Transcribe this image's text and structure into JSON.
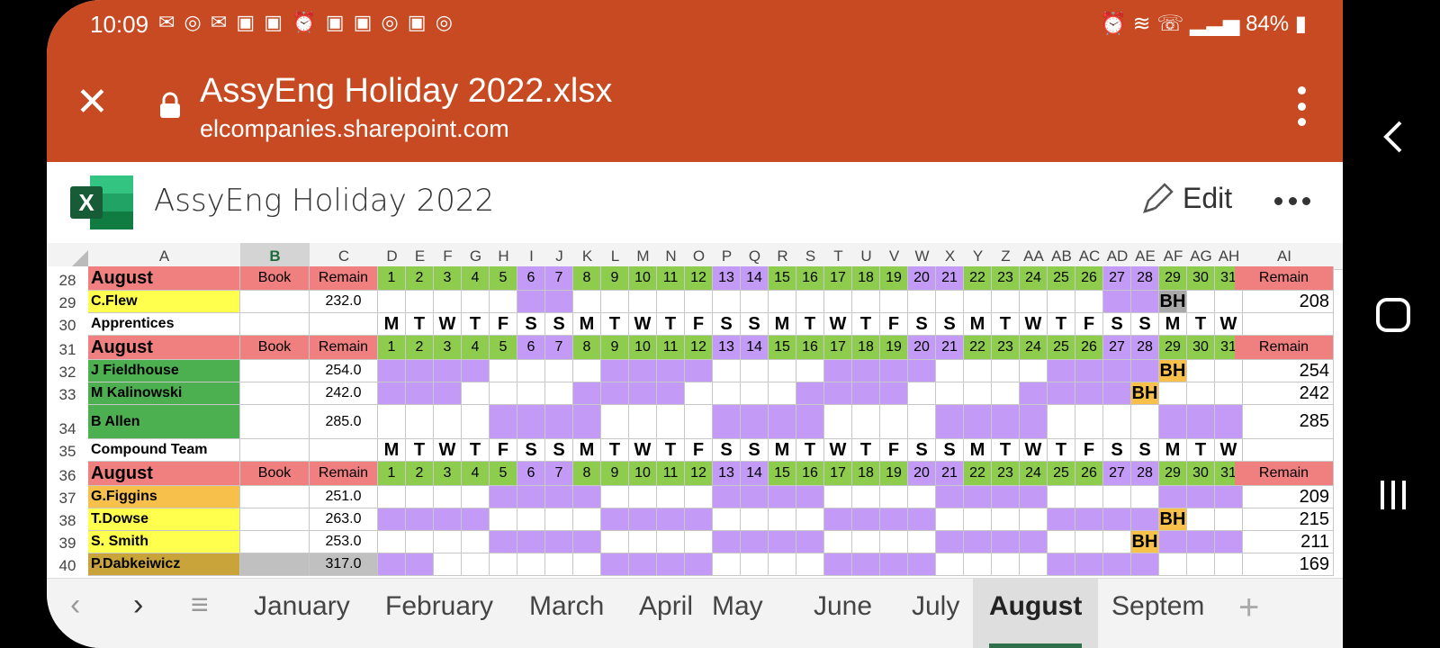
{
  "status": {
    "time": "10:09",
    "battery": "84%"
  },
  "browser": {
    "title": "AssyEng Holiday 2022.xlsx",
    "host": "elcompanies.sharepoint.com"
  },
  "excel": {
    "doc_title": "AssyEng Holiday 2022",
    "edit_label": "Edit"
  },
  "colors": {
    "brand": "#c84a22",
    "purple": "#c39bf7",
    "green_hdr": "#8dcc4d",
    "salmon": "#f08080",
    "name_green": "#4caf50",
    "name_yellow": "#ffff4d",
    "name_orange": "#f7c04a",
    "bh": "#f7c04a"
  },
  "columns": [
    "A",
    "B",
    "C",
    "D",
    "E",
    "F",
    "G",
    "H",
    "I",
    "J",
    "K",
    "L",
    "M",
    "N",
    "O",
    "P",
    "Q",
    "R",
    "S",
    "T",
    "U",
    "V",
    "W",
    "X",
    "Y",
    "Z",
    "AA",
    "AB",
    "AC",
    "AD",
    "AE",
    "AF",
    "AG",
    "AH",
    "AI"
  ],
  "weekdays": [
    "M",
    "T",
    "W",
    "T",
    "F",
    "S",
    "S",
    "M",
    "T",
    "W",
    "T",
    "F",
    "S",
    "S",
    "M",
    "T",
    "W",
    "T",
    "F",
    "S",
    "S",
    "M",
    "T",
    "W",
    "T",
    "F",
    "S",
    "S",
    "M",
    "T",
    "W"
  ],
  "days": [
    "1",
    "2",
    "3",
    "4",
    "5",
    "6",
    "7",
    "8",
    "9",
    "10",
    "11",
    "12",
    "13",
    "14",
    "15",
    "16",
    "17",
    "18",
    "19",
    "20",
    "21",
    "22",
    "23",
    "24",
    "25",
    "26",
    "27",
    "28",
    "29",
    "30",
    "31"
  ],
  "rows": [
    {
      "num": "28",
      "type": "header",
      "month": "August",
      "book": "Book",
      "remain": "Remain",
      "remain2": "Remain"
    },
    {
      "num": "29",
      "type": "person",
      "name": "C.Flew",
      "color": "yellow",
      "remain": "232.0",
      "total": "208",
      "purple": [
        6,
        7,
        27,
        28
      ],
      "bh": 29,
      "bh_grey": true
    },
    {
      "num": "30",
      "type": "weekday",
      "label": "Apprentices"
    },
    {
      "num": "31",
      "type": "header",
      "month": "August",
      "book": "Book",
      "remain": "Remain",
      "remain2": "Remain"
    },
    {
      "num": "32",
      "type": "person",
      "name": "J Fieldhouse",
      "color": "green",
      "remain": "254.0",
      "total": "254",
      "purple": [
        1,
        2,
        3,
        4,
        9,
        10,
        11,
        12,
        17,
        18,
        19,
        20,
        25,
        26,
        27,
        28
      ],
      "bh": 29
    },
    {
      "num": "33",
      "type": "person",
      "name": "M Kalinowski",
      "color": "green",
      "remain": "242.0",
      "total": "242",
      "purple": [
        1,
        2,
        3,
        8,
        9,
        10,
        11,
        16,
        17,
        18,
        19,
        24,
        25,
        26,
        27
      ],
      "bh": 28
    },
    {
      "num": "34",
      "type": "person",
      "name": "B Allen",
      "color": "green",
      "remain": "285.0",
      "total": "285",
      "purple": [
        5,
        6,
        7,
        8,
        13,
        14,
        15,
        16,
        21,
        22,
        23,
        24,
        29,
        30,
        31
      ],
      "tall": true
    },
    {
      "num": "35",
      "type": "weekday",
      "label": "Compound Team"
    },
    {
      "num": "36",
      "type": "header",
      "month": "August",
      "book": "Book",
      "remain": "Remain",
      "remain2": "Remain"
    },
    {
      "num": "37",
      "type": "person",
      "name": "G.Figgins",
      "color": "orange",
      "remain": "251.0",
      "total": "209",
      "purple": [
        5,
        6,
        7,
        8,
        13,
        14,
        15,
        16,
        21,
        22,
        23,
        24,
        29,
        30,
        31
      ]
    },
    {
      "num": "38",
      "type": "person",
      "name": "T.Dowse",
      "color": "yellow",
      "remain": "263.0",
      "total": "215",
      "purple": [
        1,
        2,
        3,
        4,
        9,
        10,
        11,
        12,
        17,
        18,
        19,
        20,
        25,
        26,
        27,
        28
      ],
      "bh": 29
    },
    {
      "num": "39",
      "type": "person",
      "name": "S. Smith",
      "color": "yellow",
      "remain": "253.0",
      "total": "211",
      "purple": [
        5,
        6,
        7,
        8,
        13,
        14,
        15,
        16,
        21,
        22,
        23,
        24,
        29,
        30,
        31
      ],
      "bh": 28
    },
    {
      "num": "40",
      "type": "person",
      "name": "P.Dabkeiwicz",
      "color": "olive",
      "remain": "317.0",
      "total": "169",
      "purple": [
        1,
        2,
        9,
        10,
        11,
        12,
        17,
        18,
        19,
        20,
        25,
        26,
        27,
        28
      ],
      "cut": true
    }
  ],
  "tabs": [
    "January",
    "February",
    "March",
    "April",
    "May",
    "June",
    "July",
    "August",
    "Septem"
  ],
  "active_tab": "August"
}
